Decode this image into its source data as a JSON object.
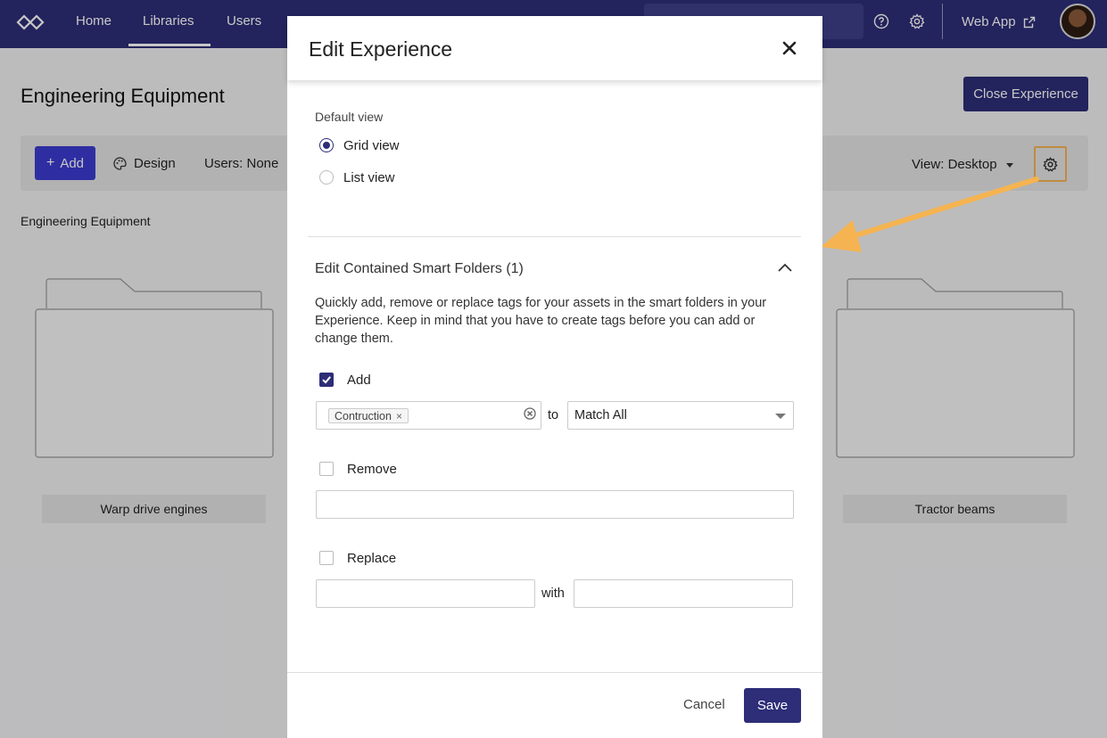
{
  "nav": {
    "links": [
      "Home",
      "Libraries",
      "Users"
    ],
    "active": "Libraries",
    "web_app": "Web App"
  },
  "page": {
    "title": "Engineering Equipment",
    "close_experience": "Close Experience",
    "add": "Add",
    "design": "Design",
    "users_filter": "Users: None",
    "view_select": "View: Desktop",
    "breadcrumb": "Engineering Equipment",
    "folders": [
      "Warp drive engines",
      "Tractor beams"
    ]
  },
  "modal": {
    "title": "Edit Experience",
    "default_view_label": "Default view",
    "view_options": [
      "Grid view",
      "List view"
    ],
    "selected_view": "Grid view",
    "section_title": "Edit Contained Smart Folders (1)",
    "description": "Quickly add, remove or replace tags for your assets in the smart folders in your Experience. Keep in mind that you have to create tags before you can add or change them.",
    "add": {
      "label": "Add",
      "checked": true,
      "tags": [
        "Contruction"
      ],
      "to_label": "to",
      "match": "Match All"
    },
    "remove": {
      "label": "Remove",
      "checked": false,
      "value": ""
    },
    "replace": {
      "label": "Replace",
      "checked": false,
      "with_label": "with",
      "from": "",
      "to": ""
    },
    "cancel": "Cancel",
    "save": "Save"
  },
  "colors": {
    "brand": "#2d2d78",
    "accent": "#3b3bd0",
    "highlight": "#f5b451"
  }
}
